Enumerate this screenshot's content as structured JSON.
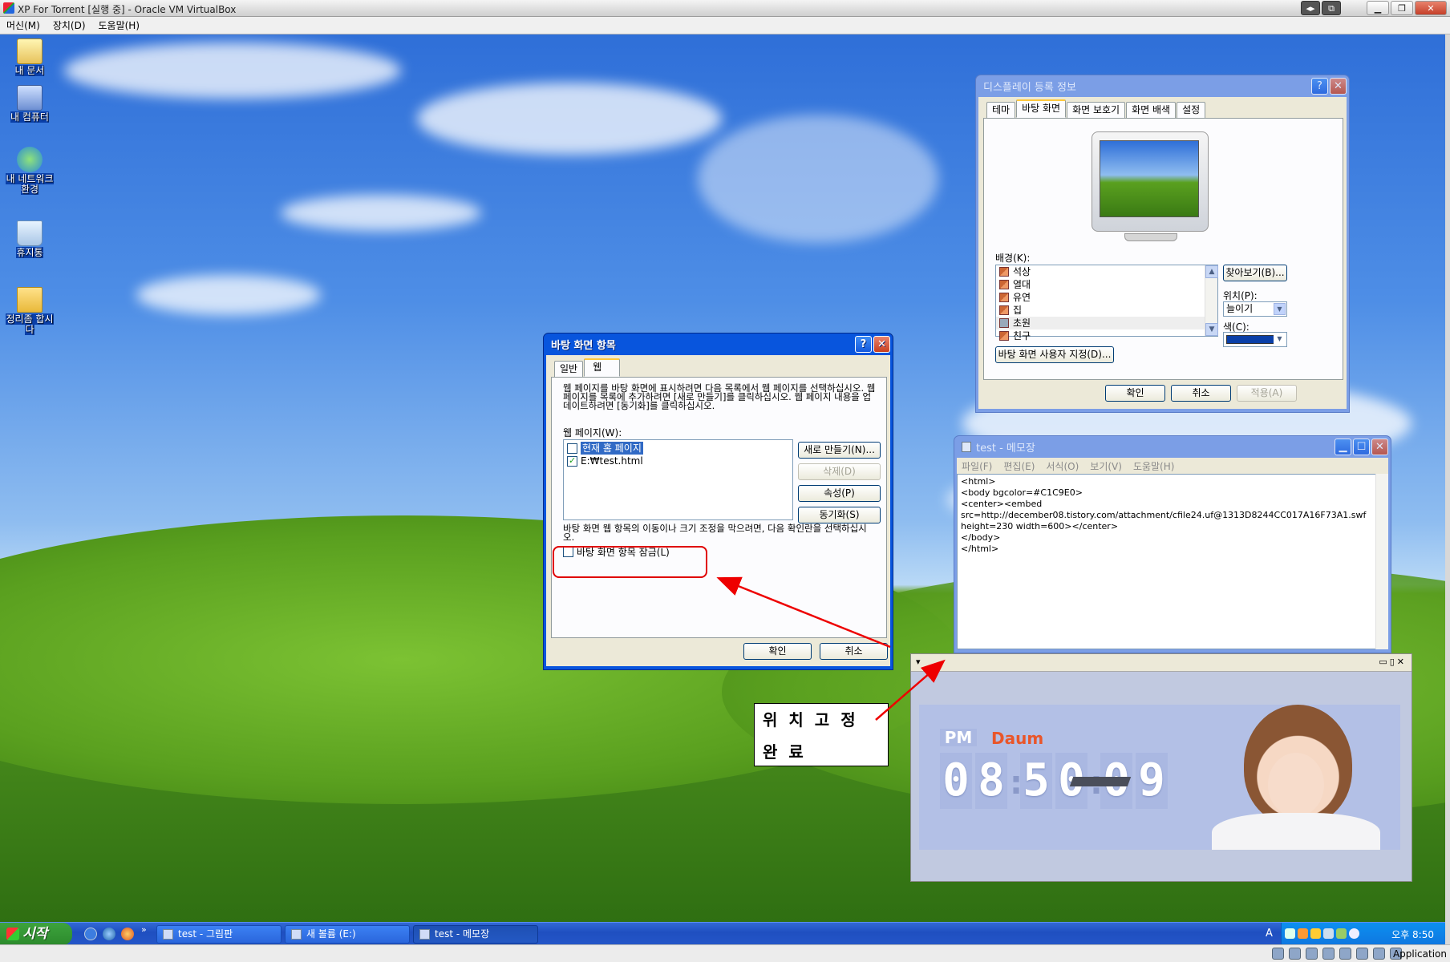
{
  "host": {
    "title": "XP For Torrent [실행 중] - Oracle VM VirtualBox",
    "menu": [
      "머신(M)",
      "장치(D)",
      "도움말(H)"
    ],
    "status_label": "Application"
  },
  "desktop_icons": [
    {
      "label": "내 문서",
      "icon": "my-documents-icon"
    },
    {
      "label": "내 컴퓨터",
      "icon": "my-computer-icon"
    },
    {
      "label": "내 네트워크 환경",
      "icon": "network-icon"
    },
    {
      "label": "휴지통",
      "icon": "recycle-bin-icon"
    },
    {
      "label": "정리좀 합시다",
      "icon": "folder-icon"
    }
  ],
  "display_props": {
    "title": "디스플레이 등록 정보",
    "tabs": [
      "테마",
      "바탕 화면",
      "화면 보호기",
      "화면 배색",
      "설정"
    ],
    "selected_tab": 1,
    "background_label": "배경(K):",
    "backgrounds": [
      "석상",
      "열대",
      "유연",
      "집",
      "초원",
      "친구"
    ],
    "selected_background": 4,
    "browse_button": "찾아보기(B)...",
    "position_label": "위치(P):",
    "position_value": "늘이기",
    "color_label": "색(C):",
    "color_value": "#0a3fa8",
    "customize_button": "바탕 화면 사용자 지정(D)...",
    "ok": "확인",
    "cancel": "취소",
    "apply": "적용(A)"
  },
  "desktop_items": {
    "title": "바탕 화면 항목",
    "tabs": [
      "일반",
      "웹"
    ],
    "selected_tab": 1,
    "description": "웹 페이지를 바탕 화면에 표시하려면 다음 목록에서 웹 페이지를 선택하십시오. 웹 페이지를 목록에 추가하려면 [새로 만들기]를 클릭하십시오. 웹 페이지 내용을 업데이트하려면 [동기화]를 클릭하십시오.",
    "webpages_label": "웹 페이지(W):",
    "webpages": [
      {
        "label": "현재 홈 페이지",
        "checked": false,
        "selected": true
      },
      {
        "label": "E:₩test.html",
        "checked": true,
        "selected": false
      }
    ],
    "new_button": "새로 만들기(N)...",
    "delete_button": "삭제(D)",
    "properties_button": "속성(P)",
    "sync_button": "동기화(S)",
    "lock_description": "바탕 화면 웹 항목의 이동이나 크기 조정을 막으려면, 다음 확인란을 선택하십시오.",
    "lock_checkbox": "바탕 화면 항목 잠금(L)",
    "ok": "확인",
    "cancel": "취소"
  },
  "notepad": {
    "title": "test - 메모장",
    "menu": [
      "파일(F)",
      "편집(E)",
      "서식(O)",
      "보기(V)",
      "도움말(H)"
    ],
    "content": "<html>\n<body bgcolor=#C1C9E0>\n<center><embed\nsrc=http://december08.tistory.com/attachment/cfile24.uf@1313D8244CC017A16F73A1.swf\nheight=230 width=600></center>\n</body>\n</html>"
  },
  "clock_widget": {
    "bar_left": "▾",
    "bar_right": "▭▯✕",
    "ampm": "PM",
    "brand": "Daum",
    "digits": [
      "0",
      "8",
      "5",
      "0",
      "0",
      "9"
    ]
  },
  "annotation": {
    "line1": "위치고정",
    "line2": "완료",
    "color": "#e00000"
  },
  "taskbar": {
    "start": "시작",
    "tasks": [
      "test - 그림판",
      "새 볼륨 (E:)",
      "test - 메모장"
    ],
    "active_task": 2,
    "tray_time": "오후 8:50",
    "tray_lang": "A"
  }
}
